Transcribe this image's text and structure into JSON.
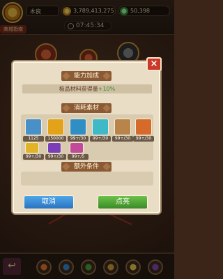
{
  "topbar": {
    "player_name": "木良",
    "avatar_label": "商城指南",
    "gold": "3,789,413,275",
    "gems": "50,398",
    "timer": "07:45:34"
  },
  "dialog": {
    "section_ability": "能力加成",
    "effect_text_prefix": "极品材料获得量",
    "effect_text_value": "+10%",
    "section_materials": "消耗素材",
    "materials": [
      {
        "name": "mat-1",
        "count": "1125",
        "color": "#4a90c8"
      },
      {
        "name": "mat-2",
        "count": "150000",
        "color": "#e2a21a"
      },
      {
        "name": "mat-3",
        "count": "99+/30",
        "color": "#2f8fc4"
      },
      {
        "name": "mat-4",
        "count": "99+/30",
        "color": "#3fb8c8"
      },
      {
        "name": "mat-5",
        "count": "99+/30",
        "color": "#b8844a"
      },
      {
        "name": "mat-6",
        "count": "99+/30",
        "color": "#d66a2a"
      },
      {
        "name": "mat-7",
        "count": "99+/30",
        "color": "#e0b424"
      },
      {
        "name": "mat-8",
        "count": "99+/30",
        "color": "#7a3fb8"
      },
      {
        "name": "mat-9",
        "count": "99+/5",
        "color": "#c24a9a"
      }
    ],
    "section_extra": "额外条件",
    "cancel_label": "取消",
    "confirm_label": "点亮"
  },
  "bottombar": {
    "back_icon": "↩"
  },
  "colors": {
    "cancel": "#3a8ad6",
    "confirm": "#4ea838",
    "close": "#c93a2a"
  }
}
